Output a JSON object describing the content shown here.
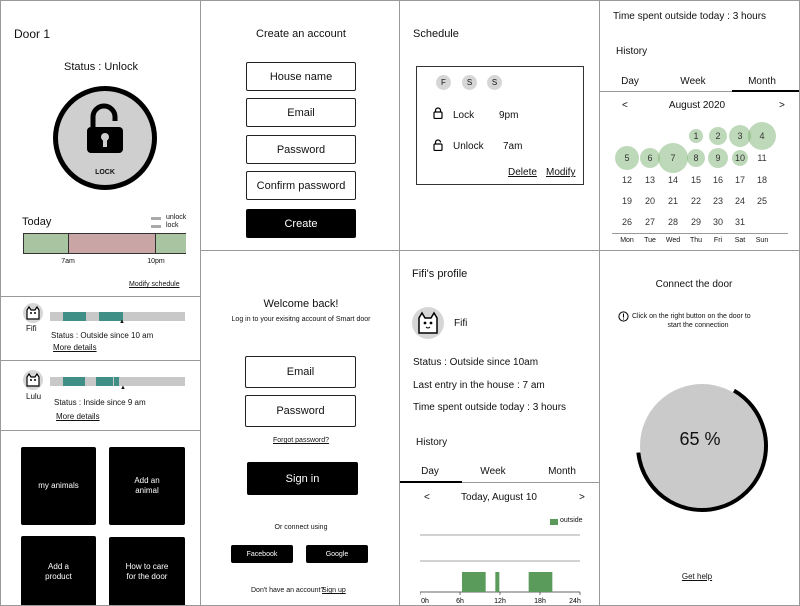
{
  "door": {
    "title": "Door 1",
    "status": "Status : Unlock",
    "lock_label": "LOCK",
    "today_label": "Today",
    "legend": {
      "unlock": "unlock",
      "lock": "lock"
    },
    "ticks": [
      "7am",
      "10pm"
    ],
    "modify_link": "Modify schedule",
    "colors": {
      "unlock": "#a9c4a0",
      "lock": "#c9a5a5"
    }
  },
  "pets_list": [
    {
      "name": "Fifi",
      "status": "Status : Outside since 10 am",
      "more": "More details"
    },
    {
      "name": "Lulu",
      "status": "Status : Inside since 9 am",
      "more": "More details"
    }
  ],
  "tiles": {
    "my_animals": "my animals",
    "add_animal": "Add an\nanimal",
    "add_product": "Add a\nproduct",
    "care": "How to care\nfor the door"
  },
  "create_account": {
    "title": "Create an account",
    "house_name": "House name",
    "email": "Email",
    "password": "Password",
    "confirm": "Confirm password",
    "create": "Create"
  },
  "signin": {
    "title": "Welcome back!",
    "subtitle": "Log in to your exisitng account of Smart door",
    "email": "Email",
    "password": "Password",
    "forgot": "Forgot password?",
    "signin_button": "Sign in",
    "connect_using": "Or connect using",
    "facebook": "Facebook",
    "google": "Google",
    "no_account": "Don't  have an account?",
    "signup": "Sign up"
  },
  "schedule": {
    "title": "Schedule",
    "days": [
      "F",
      "S",
      "S"
    ],
    "lock_label": "Lock",
    "lock_time": "9pm",
    "unlock_label": "Unlock",
    "unlock_time": "7am",
    "delete": "Delete",
    "modify": "Modify"
  },
  "profile": {
    "title": "Fifi's profile",
    "name": "Fifi",
    "status": "Status : Outside since 10am",
    "last_entry": "Last entry in the house : 7 am",
    "time_outside": "Time spent outside today : 3 hours",
    "history": "History",
    "tabs": [
      "Day",
      "Week",
      "Month"
    ],
    "date": "Today, August 10",
    "prev": "<",
    "next": ">",
    "legend": "outside",
    "chart_color": "#5a9a5a"
  },
  "chart_data": {
    "type": "bar",
    "x_ticks": [
      "0h",
      "6h",
      "12h",
      "18h",
      "24h"
    ],
    "xlim": [
      0,
      24
    ],
    "series": [
      {
        "name": "outside",
        "intervals": [
          [
            6,
            10
          ],
          [
            11,
            12
          ],
          [
            16,
            20
          ]
        ]
      }
    ]
  },
  "history": {
    "time_outside": "Time spent outside today : 3 hours",
    "title": "History",
    "tabs": [
      "Day",
      "Week",
      "Month"
    ],
    "month": "August 2020",
    "prev": "<",
    "next": ">",
    "weekdays": [
      "Mon",
      "Tue",
      "Wed",
      "Thu",
      "Fri",
      "Sat",
      "Sun"
    ],
    "rows": [
      [
        "",
        "",
        "",
        "1",
        "2",
        "3",
        "4"
      ],
      [
        "5",
        "6",
        "7",
        "8",
        "9",
        "10",
        "11"
      ],
      [
        "12",
        "13",
        "14",
        "15",
        "16",
        "17",
        "18"
      ],
      [
        "19",
        "20",
        "21",
        "22",
        "23",
        "24",
        "25"
      ],
      [
        "26",
        "27",
        "28",
        "29",
        "30",
        "31",
        ""
      ]
    ],
    "highlighted_days": [
      "1",
      "2",
      "3",
      "4",
      "5",
      "6",
      "7",
      "8",
      "9",
      "10"
    ]
  },
  "connect": {
    "title": "Connect the door",
    "instruction_line1": "Click on the right button on the door to",
    "instruction_line2": "start the connection",
    "percent": "65 %",
    "progress": 0.65,
    "help": "Get help"
  }
}
